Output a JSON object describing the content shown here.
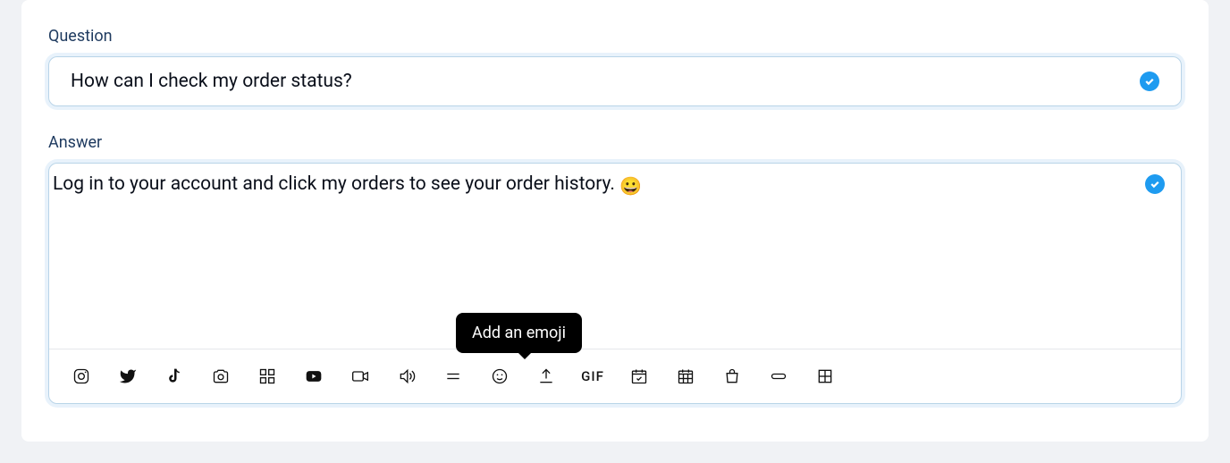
{
  "question": {
    "label": "Question",
    "value": "How can I check my order status?"
  },
  "answer": {
    "label": "Answer",
    "value": "Log in to your account and click my orders to see your order history. ",
    "emoji": "😀"
  },
  "toolbar": {
    "gif_label": "GIF",
    "tooltip": "Add an emoji"
  }
}
